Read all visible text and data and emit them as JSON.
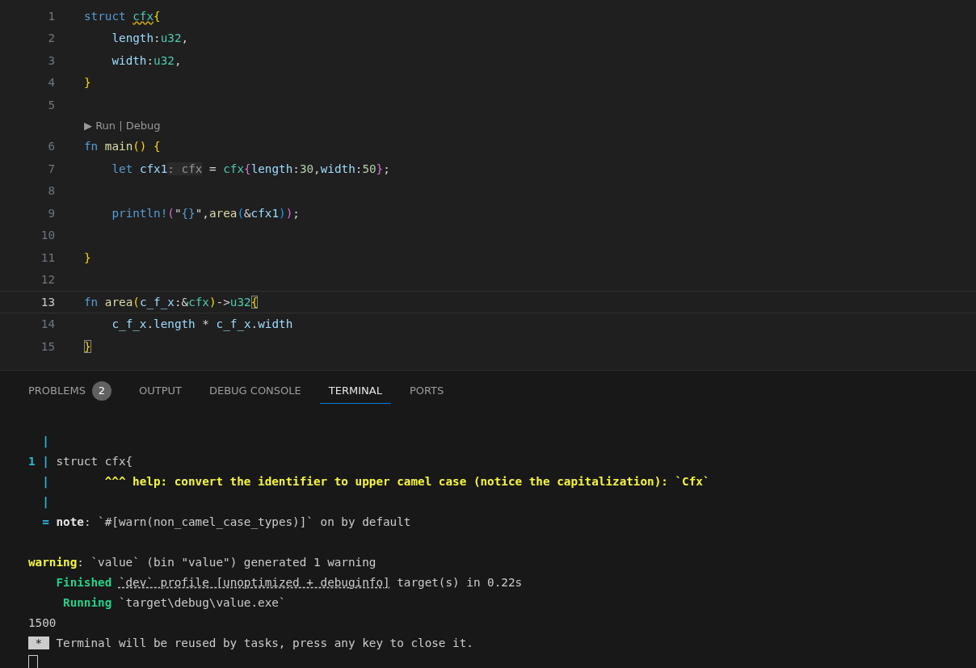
{
  "editor": {
    "lines": [
      {
        "kind": "code",
        "number": "1",
        "current": false,
        "tokens": [
          {
            "t": "struct ",
            "kind": "kw"
          },
          {
            "t": "cfx",
            "kind": "type",
            "squiggle": true
          },
          {
            "t": "{",
            "kind": "brace1"
          }
        ]
      },
      {
        "kind": "code",
        "number": "2",
        "current": false,
        "tokens": [
          {
            "t": "    length",
            "kind": "var"
          },
          {
            "t": ":",
            "kind": "punct"
          },
          {
            "t": "u32",
            "kind": "type"
          },
          {
            "t": ",",
            "kind": "punct"
          }
        ]
      },
      {
        "kind": "code",
        "number": "3",
        "current": false,
        "tokens": [
          {
            "t": "    width",
            "kind": "var"
          },
          {
            "t": ":",
            "kind": "punct"
          },
          {
            "t": "u32",
            "kind": "type"
          },
          {
            "t": ",",
            "kind": "punct"
          }
        ]
      },
      {
        "kind": "code",
        "number": "4",
        "current": false,
        "tokens": [
          {
            "t": "}",
            "kind": "brace1"
          }
        ]
      },
      {
        "kind": "code",
        "number": "5",
        "current": false
      },
      {
        "kind": "codelens",
        "text": "▶ Run | Debug"
      },
      {
        "kind": "code",
        "number": "6",
        "current": false,
        "tokens": [
          {
            "t": "fn ",
            "kind": "kw"
          },
          {
            "t": "main",
            "kind": "fn"
          },
          {
            "t": "() {",
            "kind": "brace1"
          }
        ]
      },
      {
        "kind": "code",
        "number": "7",
        "current": false,
        "tokens": [
          {
            "t": "    let ",
            "kind": "kw"
          },
          {
            "t": "cfx1",
            "kind": "var"
          },
          {
            "t": ": cfx",
            "kind": "hint"
          },
          {
            "t": " = ",
            "kind": "punct"
          },
          {
            "t": "cfx",
            "kind": "type"
          },
          {
            "t": "{",
            "kind": "brace2"
          },
          {
            "t": "length",
            "kind": "var"
          },
          {
            "t": ":",
            "kind": "punct"
          },
          {
            "t": "30",
            "kind": "num"
          },
          {
            "t": ",",
            "kind": "punct"
          },
          {
            "t": "width",
            "kind": "var"
          },
          {
            "t": ":",
            "kind": "punct"
          },
          {
            "t": "50",
            "kind": "num"
          },
          {
            "t": "}",
            "kind": "brace2"
          },
          {
            "t": ";",
            "kind": "punct"
          }
        ]
      },
      {
        "kind": "code",
        "number": "8",
        "current": false
      },
      {
        "kind": "code",
        "number": "9",
        "current": false,
        "tokens": [
          {
            "t": "    println!",
            "kind": "macro"
          },
          {
            "t": "(",
            "kind": "brace2"
          },
          {
            "t": "\"",
            "kind": "punct"
          },
          {
            "t": "{}",
            "kind": "macro"
          },
          {
            "t": "\",",
            "kind": "punct"
          },
          {
            "t": "area",
            "kind": "fn"
          },
          {
            "t": "(",
            "kind": "brace3"
          },
          {
            "t": "&",
            "kind": "punct"
          },
          {
            "t": "cfx1",
            "kind": "var"
          },
          {
            "t": ")",
            "kind": "brace3"
          },
          {
            "t": ")",
            "kind": "brace2"
          },
          {
            "t": ";",
            "kind": "punct"
          }
        ]
      },
      {
        "kind": "code",
        "number": "10",
        "current": false
      },
      {
        "kind": "code",
        "number": "11",
        "current": false,
        "tokens": [
          {
            "t": "}",
            "kind": "brace1"
          }
        ]
      },
      {
        "kind": "code",
        "number": "12",
        "current": false
      },
      {
        "kind": "code",
        "number": "13",
        "current": true,
        "tokens": [
          {
            "t": "fn ",
            "kind": "kw"
          },
          {
            "t": "area",
            "kind": "fn"
          },
          {
            "t": "(",
            "kind": "brace1"
          },
          {
            "t": "c_f_x",
            "kind": "var"
          },
          {
            "t": ":&",
            "kind": "punct"
          },
          {
            "t": "cfx",
            "kind": "type"
          },
          {
            "t": ")",
            "kind": "brace1"
          },
          {
            "t": "->",
            "kind": "punct"
          },
          {
            "t": "u32",
            "kind": "type"
          },
          {
            "t": "{",
            "kind": "brace1",
            "matched": true
          }
        ]
      },
      {
        "kind": "code",
        "number": "14",
        "current": false,
        "tokens": [
          {
            "t": "    c_f_x",
            "kind": "var"
          },
          {
            "t": ".",
            "kind": "punct"
          },
          {
            "t": "length",
            "kind": "var"
          },
          {
            "t": " * ",
            "kind": "punct"
          },
          {
            "t": "c_f_x",
            "kind": "var"
          },
          {
            "t": ".",
            "kind": "punct"
          },
          {
            "t": "width",
            "kind": "var"
          }
        ]
      },
      {
        "kind": "code",
        "number": "15",
        "current": false,
        "tokens": [
          {
            "t": "}",
            "kind": "brace1",
            "matched": true
          }
        ]
      }
    ]
  },
  "panel": {
    "tabs": [
      {
        "label": "PROBLEMS",
        "badge": "2",
        "selected": false
      },
      {
        "label": "OUTPUT",
        "selected": false
      },
      {
        "label": "DEBUG CONSOLE",
        "selected": false
      },
      {
        "label": "TERMINAL",
        "selected": true
      },
      {
        "label": "PORTS",
        "selected": false
      }
    ],
    "terminal": [
      {
        "segs": [
          {
            "t": "  |",
            "kind": "gutter"
          }
        ]
      },
      {
        "segs": [
          {
            "t": "1 |",
            "kind": "gutter"
          },
          {
            "t": " struct cfx{",
            "kind": "text"
          }
        ]
      },
      {
        "segs": [
          {
            "t": "  |",
            "kind": "gutter"
          },
          {
            "t": "        ^^^ help: convert the identifier to upper camel case (notice the capitalization): `Cfx`",
            "kind": "help"
          }
        ]
      },
      {
        "segs": [
          {
            "t": "  |",
            "kind": "gutter"
          }
        ]
      },
      {
        "segs": [
          {
            "t": "  =",
            "kind": "gutter"
          },
          {
            "t": " note",
            "kind": "label"
          },
          {
            "t": ": `#[warn(non_camel_case_types)]` on by default",
            "kind": "text"
          }
        ]
      },
      {
        "kind": "blank"
      },
      {
        "segs": [
          {
            "t": "warning",
            "kind": "warning"
          },
          {
            "t": ": `value` (bin \"value\") generated 1 warning",
            "kind": "text"
          }
        ]
      },
      {
        "segs": [
          {
            "t": "    Finished ",
            "kind": "green"
          },
          {
            "t": "`dev` profile [unoptimized + debuginfo]",
            "kind": "link"
          },
          {
            "t": " target(s) in 0.22s",
            "kind": "text"
          }
        ]
      },
      {
        "segs": [
          {
            "t": "     Running",
            "kind": "green"
          },
          {
            "t": " `target\\debug\\value.exe`",
            "kind": "text"
          }
        ]
      },
      {
        "segs": [
          {
            "t": "1500",
            "kind": "text"
          }
        ]
      },
      {
        "segs": [
          {
            "t": " * ",
            "kind": "inverse"
          },
          {
            "t": " Terminal will be reused by tasks, press any key to close it.",
            "kind": "text"
          }
        ]
      }
    ]
  }
}
